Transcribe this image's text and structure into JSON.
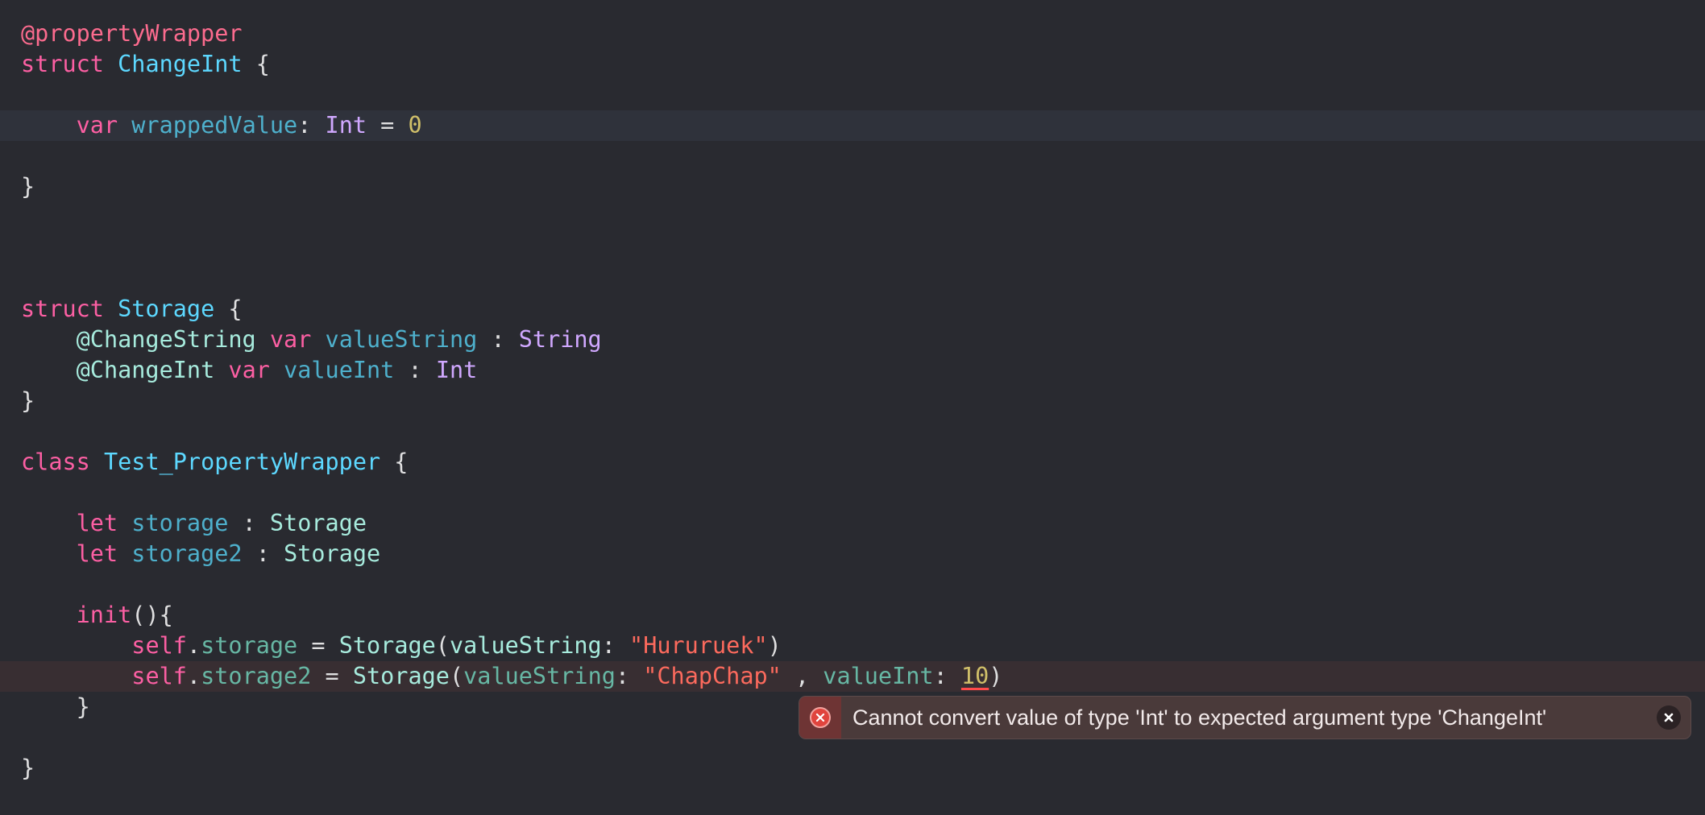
{
  "code": {
    "lines": [
      {
        "tokens": [
          {
            "t": "@propertyWrapper",
            "c": "attr"
          }
        ]
      },
      {
        "tokens": [
          {
            "t": "struct",
            "c": "kw"
          },
          {
            "t": " ",
            "c": "plain"
          },
          {
            "t": "ChangeInt",
            "c": "type"
          },
          {
            "t": " {",
            "c": "plain"
          }
        ]
      },
      {
        "tokens": []
      },
      {
        "tokens": [
          {
            "t": "    ",
            "c": "plain"
          },
          {
            "t": "var",
            "c": "kw"
          },
          {
            "t": " ",
            "c": "plain"
          },
          {
            "t": "wrappedValue",
            "c": "prop"
          },
          {
            "t": ": ",
            "c": "plain"
          },
          {
            "t": "Int",
            "c": "sysType"
          },
          {
            "t": " = ",
            "c": "plain"
          },
          {
            "t": "0",
            "c": "num"
          }
        ],
        "highlight": "current"
      },
      {
        "tokens": []
      },
      {
        "tokens": [
          {
            "t": "}",
            "c": "plain"
          }
        ]
      },
      {
        "tokens": []
      },
      {
        "tokens": []
      },
      {
        "tokens": []
      },
      {
        "tokens": [
          {
            "t": "struct",
            "c": "kw"
          },
          {
            "t": " ",
            "c": "plain"
          },
          {
            "t": "Storage",
            "c": "type"
          },
          {
            "t": " {",
            "c": "plain"
          }
        ]
      },
      {
        "tokens": [
          {
            "t": "    ",
            "c": "plain"
          },
          {
            "t": "@ChangeString",
            "c": "otherType"
          },
          {
            "t": " ",
            "c": "plain"
          },
          {
            "t": "var",
            "c": "kw"
          },
          {
            "t": " ",
            "c": "plain"
          },
          {
            "t": "valueString",
            "c": "prop"
          },
          {
            "t": " : ",
            "c": "plain"
          },
          {
            "t": "String",
            "c": "sysType"
          }
        ]
      },
      {
        "tokens": [
          {
            "t": "    ",
            "c": "plain"
          },
          {
            "t": "@ChangeInt",
            "c": "otherType"
          },
          {
            "t": " ",
            "c": "plain"
          },
          {
            "t": "var",
            "c": "kw"
          },
          {
            "t": " ",
            "c": "plain"
          },
          {
            "t": "valueInt",
            "c": "prop"
          },
          {
            "t": " : ",
            "c": "plain"
          },
          {
            "t": "Int",
            "c": "sysType"
          }
        ]
      },
      {
        "tokens": [
          {
            "t": "}",
            "c": "plain"
          }
        ]
      },
      {
        "tokens": []
      },
      {
        "tokens": [
          {
            "t": "class",
            "c": "kw"
          },
          {
            "t": " ",
            "c": "plain"
          },
          {
            "t": "Test_PropertyWrapper",
            "c": "type"
          },
          {
            "t": " {",
            "c": "plain"
          }
        ]
      },
      {
        "tokens": []
      },
      {
        "tokens": [
          {
            "t": "    ",
            "c": "plain"
          },
          {
            "t": "let",
            "c": "kw"
          },
          {
            "t": " ",
            "c": "plain"
          },
          {
            "t": "storage",
            "c": "prop"
          },
          {
            "t": " : ",
            "c": "plain"
          },
          {
            "t": "Storage",
            "c": "otherType"
          }
        ]
      },
      {
        "tokens": [
          {
            "t": "    ",
            "c": "plain"
          },
          {
            "t": "let",
            "c": "kw"
          },
          {
            "t": " ",
            "c": "plain"
          },
          {
            "t": "storage2",
            "c": "prop"
          },
          {
            "t": " : ",
            "c": "plain"
          },
          {
            "t": "Storage",
            "c": "otherType"
          }
        ]
      },
      {
        "tokens": []
      },
      {
        "tokens": [
          {
            "t": "    ",
            "c": "plain"
          },
          {
            "t": "init",
            "c": "kw"
          },
          {
            "t": "(){",
            "c": "plain"
          }
        ]
      },
      {
        "tokens": [
          {
            "t": "        ",
            "c": "plain"
          },
          {
            "t": "self",
            "c": "kw"
          },
          {
            "t": ".",
            "c": "plain"
          },
          {
            "t": "storage",
            "c": "otherProp"
          },
          {
            "t": " = ",
            "c": "plain"
          },
          {
            "t": "Storage",
            "c": "otherType"
          },
          {
            "t": "(",
            "c": "plain"
          },
          {
            "t": "valueString",
            "c": "otherType"
          },
          {
            "t": ": ",
            "c": "plain"
          },
          {
            "t": "\"Hururuek\"",
            "c": "str"
          },
          {
            "t": ")",
            "c": "plain"
          }
        ]
      },
      {
        "tokens": [
          {
            "t": "        ",
            "c": "plain"
          },
          {
            "t": "self",
            "c": "kw"
          },
          {
            "t": ".",
            "c": "plain"
          },
          {
            "t": "storage2",
            "c": "otherProp"
          },
          {
            "t": " = ",
            "c": "plain"
          },
          {
            "t": "Storage",
            "c": "otherType"
          },
          {
            "t": "(",
            "c": "plain"
          },
          {
            "t": "valueString",
            "c": "otherProp"
          },
          {
            "t": ": ",
            "c": "plain"
          },
          {
            "t": "\"ChapChap\"",
            "c": "str"
          },
          {
            "t": " , ",
            "c": "plain"
          },
          {
            "t": "valueInt",
            "c": "otherProp"
          },
          {
            "t": ": ",
            "c": "plain"
          },
          {
            "t": "10",
            "c": "num",
            "error": true
          },
          {
            "t": ")",
            "c": "plain"
          }
        ],
        "highlight": "error"
      },
      {
        "tokens": [
          {
            "t": "    ",
            "c": "plain"
          },
          {
            "t": "}",
            "c": "plain"
          }
        ]
      },
      {
        "tokens": []
      },
      {
        "tokens": [
          {
            "t": "}",
            "c": "plain"
          }
        ]
      }
    ]
  },
  "error_banner": {
    "message": "Cannot convert value of type 'Int' to expected argument type 'ChangeInt'",
    "icon": "error-circle-x-icon",
    "close_icon": "close-icon",
    "colors": {
      "background": "#4a3a3a",
      "icon_background": "#6e3434",
      "icon": "#e0443d"
    }
  },
  "theme": {
    "background": "#292a30",
    "current_line": "#2f323b",
    "error_line": "#382e32"
  }
}
